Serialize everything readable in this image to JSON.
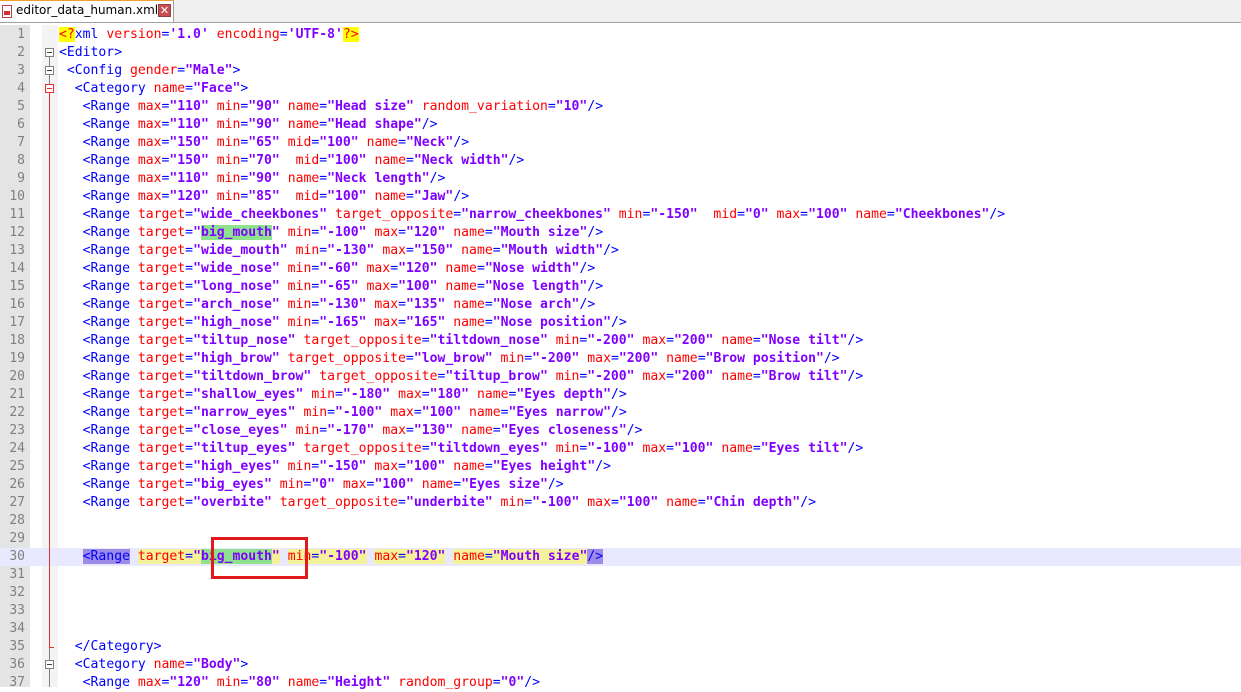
{
  "tab": {
    "filename": "editor_data_human.xml",
    "close_glyph": "✕"
  },
  "editor": {
    "current_line": 30,
    "lines": [
      {
        "n": "1",
        "t": "<?xml version='1.0' encoding='UTF-8'?>"
      },
      {
        "n": "2",
        "t": "<Editor>"
      },
      {
        "n": "3",
        "t": " <Config gender=\"Male\">"
      },
      {
        "n": "4",
        "t": "  <Category name=\"Face\">"
      },
      {
        "n": "5",
        "t": "   <Range max=\"110\" min=\"90\" name=\"Head size\" random_variation=\"10\"/>"
      },
      {
        "n": "6",
        "t": "   <Range max=\"110\" min=\"90\" name=\"Head shape\"/>"
      },
      {
        "n": "7",
        "t": "   <Range max=\"150\" min=\"65\" mid=\"100\" name=\"Neck\"/>"
      },
      {
        "n": "8",
        "t": "   <Range max=\"150\" min=\"70\"  mid=\"100\" name=\"Neck width\"/>"
      },
      {
        "n": "9",
        "t": "   <Range max=\"110\" min=\"90\" name=\"Neck length\"/>"
      },
      {
        "n": "10",
        "t": "   <Range max=\"120\" min=\"85\"  mid=\"100\" name=\"Jaw\"/>"
      },
      {
        "n": "11",
        "t": "   <Range target=\"wide_cheekbones\" target_opposite=\"narrow_cheekbones\" min=\"-150\"  mid=\"0\" max=\"100\" name=\"Cheekbones\"/>"
      },
      {
        "n": "12",
        "t": "   <Range target=\"big_mouth\" min=\"-100\" max=\"120\" name=\"Mouth size\"/>"
      },
      {
        "n": "13",
        "t": "   <Range target=\"wide_mouth\" min=\"-130\" max=\"150\" name=\"Mouth width\"/>"
      },
      {
        "n": "14",
        "t": "   <Range target=\"wide_nose\" min=\"-60\" max=\"120\" name=\"Nose width\"/>"
      },
      {
        "n": "15",
        "t": "   <Range target=\"long_nose\" min=\"-65\" max=\"100\" name=\"Nose length\"/>"
      },
      {
        "n": "16",
        "t": "   <Range target=\"arch_nose\" min=\"-130\" max=\"135\" name=\"Nose arch\"/>"
      },
      {
        "n": "17",
        "t": "   <Range target=\"high_nose\" min=\"-165\" max=\"165\" name=\"Nose position\"/>"
      },
      {
        "n": "18",
        "t": "   <Range target=\"tiltup_nose\" target_opposite=\"tiltdown_nose\" min=\"-200\" max=\"200\" name=\"Nose tilt\"/>"
      },
      {
        "n": "19",
        "t": "   <Range target=\"high_brow\" target_opposite=\"low_brow\" min=\"-200\" max=\"200\" name=\"Brow position\"/>"
      },
      {
        "n": "20",
        "t": "   <Range target=\"tiltdown_brow\" target_opposite=\"tiltup_brow\" min=\"-200\" max=\"200\" name=\"Brow tilt\"/>"
      },
      {
        "n": "21",
        "t": "   <Range target=\"shallow_eyes\" min=\"-180\" max=\"180\" name=\"Eyes depth\"/>"
      },
      {
        "n": "22",
        "t": "   <Range target=\"narrow_eyes\" min=\"-100\" max=\"100\" name=\"Eyes narrow\"/>"
      },
      {
        "n": "23",
        "t": "   <Range target=\"close_eyes\" min=\"-170\" max=\"130\" name=\"Eyes closeness\"/>"
      },
      {
        "n": "24",
        "t": "   <Range target=\"tiltup_eyes\" target_opposite=\"tiltdown_eyes\" min=\"-100\" max=\"100\" name=\"Eyes tilt\"/>"
      },
      {
        "n": "25",
        "t": "   <Range target=\"high_eyes\" min=\"-150\" max=\"100\" name=\"Eyes height\"/>"
      },
      {
        "n": "26",
        "t": "   <Range target=\"big_eyes\" min=\"0\" max=\"100\" name=\"Eyes size\"/>"
      },
      {
        "n": "27",
        "t": "   <Range target=\"overbite\" target_opposite=\"underbite\" min=\"-100\" max=\"100\" name=\"Chin depth\"/>"
      },
      {
        "n": "28",
        "t": ""
      },
      {
        "n": "29",
        "t": ""
      },
      {
        "n": "30",
        "t": "   <Range target=\"big_mouth\" min=\"-100\" max=\"120\" name=\"Mouth size\"/>"
      },
      {
        "n": "31",
        "t": ""
      },
      {
        "n": "32",
        "t": ""
      },
      {
        "n": "33",
        "t": ""
      },
      {
        "n": "34",
        "t": ""
      },
      {
        "n": "35",
        "t": "  </Category>"
      },
      {
        "n": "36",
        "t": "  <Category name=\"Body\">"
      },
      {
        "n": "37",
        "t": "   <Range max=\"120\" min=\"80\" name=\"Height\" random_group=\"0\"/>"
      }
    ],
    "highlight_word": "big_mouth"
  },
  "colors": {
    "tag": "#0000ff",
    "attr_name": "#ff0000",
    "attr_value": "#8000ff",
    "annotation_box": "#e01a1a",
    "match_highlight": "#8ee28e"
  },
  "icons": {
    "file": "file-icon",
    "close": "close-icon",
    "fold": "fold-box-icon"
  }
}
